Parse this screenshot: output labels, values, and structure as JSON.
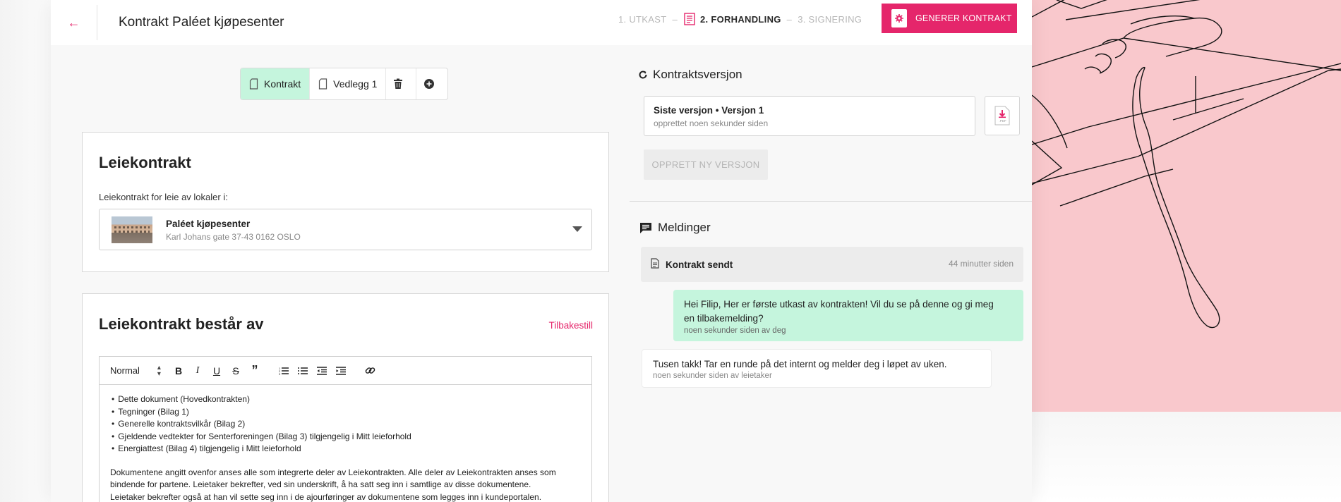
{
  "header": {
    "back_icon": "arrow-left-icon",
    "title": "Kontrakt Paléet kjøpesenter",
    "steps": [
      {
        "label": "1. UTKAST",
        "state": "done"
      },
      {
        "label": "2. FORHANDLING",
        "state": "active",
        "icon": "document-icon"
      },
      {
        "label": "3. SIGNERING",
        "state": "pending"
      }
    ],
    "step_separator": "–",
    "generate_button": "GENERER KONTRAKT",
    "accent_color": "#e5266b"
  },
  "doc_tabs": {
    "tabs": [
      "Kontrakt",
      "Vedlegg 1"
    ],
    "active": "Kontrakt",
    "delete_icon": "trash-icon",
    "add_icon": "plus-circle-icon"
  },
  "lease_card": {
    "title": "Leiekontrakt",
    "field_label": "Leiekontrakt for leie av lokaler i:",
    "location_name": "Paléet kjøpesenter",
    "location_address": "Karl Johans gate 37-43 0162 OSLO"
  },
  "composition_card": {
    "title": "Leiekontrakt består av",
    "reset_link": "Tilbakestill",
    "toolbar": {
      "format_select": "Normal",
      "buttons": [
        "bold-icon",
        "italic-icon",
        "underline-icon",
        "strikethrough-icon",
        "quote-icon",
        "ordered-list-icon",
        "bullet-list-icon",
        "outdent-icon",
        "indent-icon",
        "link-icon"
      ]
    },
    "items": [
      "Dette dokument (Hovedkontrakten)",
      "Tegninger (Bilag 1)",
      "Generelle kontraktsvilkår (Bilag 2)",
      "Gjeldende vedtekter for Senterforeningen (Bilag 3) tilgjengelig i Mitt leieforhold",
      "Energiattest (Bilag 4) tilgjengelig i Mitt leieforhold"
    ],
    "paragraph_lines": [
      "Dokumentene angitt ovenfor anses alle som integrerte deler av Leiekontrakten. Alle deler av Leiekontrakten anses som",
      "bindende for partene. Leietaker bekrefter, ved sin underskrift, å ha satt seg inn i samtlige av disse dokumentene.",
      "Leietaker bekrefter også at han vil sette seg inn i de ajourføringer av dokumentene som legges inn i kundeportalen."
    ]
  },
  "version_panel": {
    "title": "Kontraktsversjon",
    "version_label": "Siste versjon • Versjon 1",
    "version_created": "opprettet noen sekunder siden",
    "pdf_icon": "pdf-download-icon",
    "new_version_button": "OPPRETT NY VERSJON"
  },
  "messages": {
    "title": "Meldinger",
    "event": {
      "label": "Kontrakt sendt",
      "time": "44 minutter siden"
    },
    "items": [
      {
        "from": "me",
        "text_line1": "Hei Filip, Her er første utkast av kontrakten! Vil du se på denne og gi meg",
        "text_line2": "en tilbakemelding?",
        "meta": "noen sekunder siden av deg"
      },
      {
        "from": "them",
        "text_line1": "Tusen takk! Tar en runde på det internt og melder deg i løpet av uken.",
        "meta": "noen sekunder siden av leietaker"
      }
    ]
  }
}
